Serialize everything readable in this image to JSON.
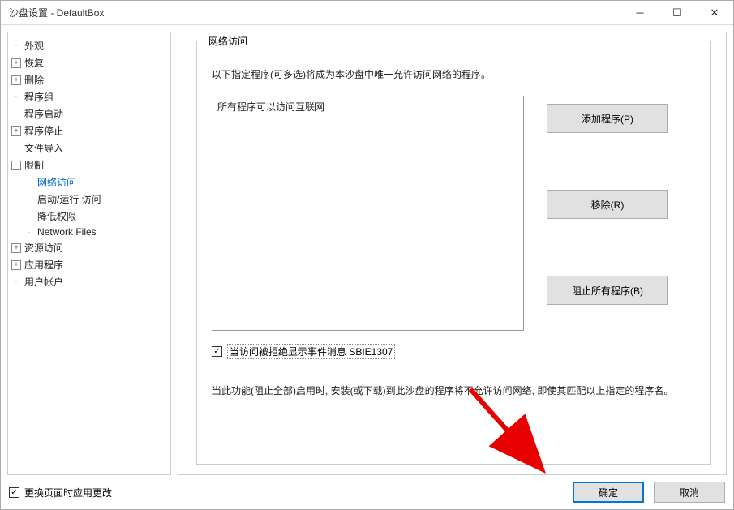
{
  "window": {
    "title": "沙盘设置 - DefaultBox"
  },
  "sidebar": {
    "items": [
      {
        "label": "外观",
        "level": 0,
        "toggle": ""
      },
      {
        "label": "恢复",
        "level": 0,
        "toggle": "+"
      },
      {
        "label": "删除",
        "level": 0,
        "toggle": "+"
      },
      {
        "label": "程序组",
        "level": 0,
        "toggle": ""
      },
      {
        "label": "程序启动",
        "level": 0,
        "toggle": ""
      },
      {
        "label": "程序停止",
        "level": 0,
        "toggle": "+"
      },
      {
        "label": "文件导入",
        "level": 0,
        "toggle": ""
      },
      {
        "label": "限制",
        "level": 0,
        "toggle": "-"
      },
      {
        "label": "网络访问",
        "level": 1,
        "toggle": "",
        "selected": true
      },
      {
        "label": "启动/运行 访问",
        "level": 1,
        "toggle": ""
      },
      {
        "label": "降低权限",
        "level": 1,
        "toggle": ""
      },
      {
        "label": "Network Files",
        "level": 1,
        "toggle": ""
      },
      {
        "label": "资源访问",
        "level": 0,
        "toggle": "+"
      },
      {
        "label": "应用程序",
        "level": 0,
        "toggle": "+"
      },
      {
        "label": "用户帐户",
        "level": 0,
        "toggle": ""
      }
    ]
  },
  "content": {
    "legend": "网络访问",
    "description": "以下指定程序(可多选)将成为本沙盘中唯一允许访问网络的程序。",
    "listbox_text": "所有程序可以访问互联网",
    "buttons": {
      "add": "添加程序(P)",
      "remove": "移除(R)",
      "block_all": "阻止所有程序(B)"
    },
    "checkbox": {
      "checked": true,
      "label": "当访问被拒绝显示事件消息 SBIE1307"
    },
    "note": "当此功能(阻止全部)启用时, 安装(或下载)到此沙盘的程序将不允许访问网络, 即使其匹配以上指定的程序名。"
  },
  "footer": {
    "apply_on_change": {
      "checked": true,
      "label": "更换页面时应用更改"
    },
    "ok": "确定",
    "cancel": "取消"
  }
}
